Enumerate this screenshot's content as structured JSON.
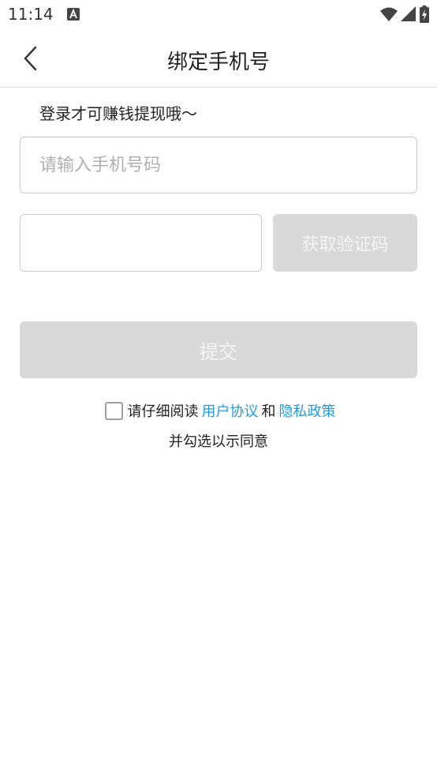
{
  "status_bar": {
    "time": "11:14",
    "icons": [
      "a-notification-icon",
      "wifi-icon",
      "signal-icon",
      "battery-charging-icon"
    ]
  },
  "header": {
    "back_icon": "chevron-left-icon",
    "title": "绑定手机号"
  },
  "form": {
    "hint": "登录才可赚钱提现哦～",
    "phone_value": "",
    "phone_placeholder": "请输入手机号码",
    "code_value": "",
    "code_placeholder": "",
    "get_code_label": "获取验证码",
    "submit_label": "提交"
  },
  "agreement": {
    "checked": false,
    "prefix": "请仔细阅读",
    "user_agreement_link": "用户协议",
    "and": "和",
    "privacy_policy_link": "隐私政策",
    "line2": "并勾选以示同意"
  },
  "colors": {
    "link": "#1e9be5",
    "disabled_button": "#d9d9d9",
    "border": "#c9c9c9"
  }
}
